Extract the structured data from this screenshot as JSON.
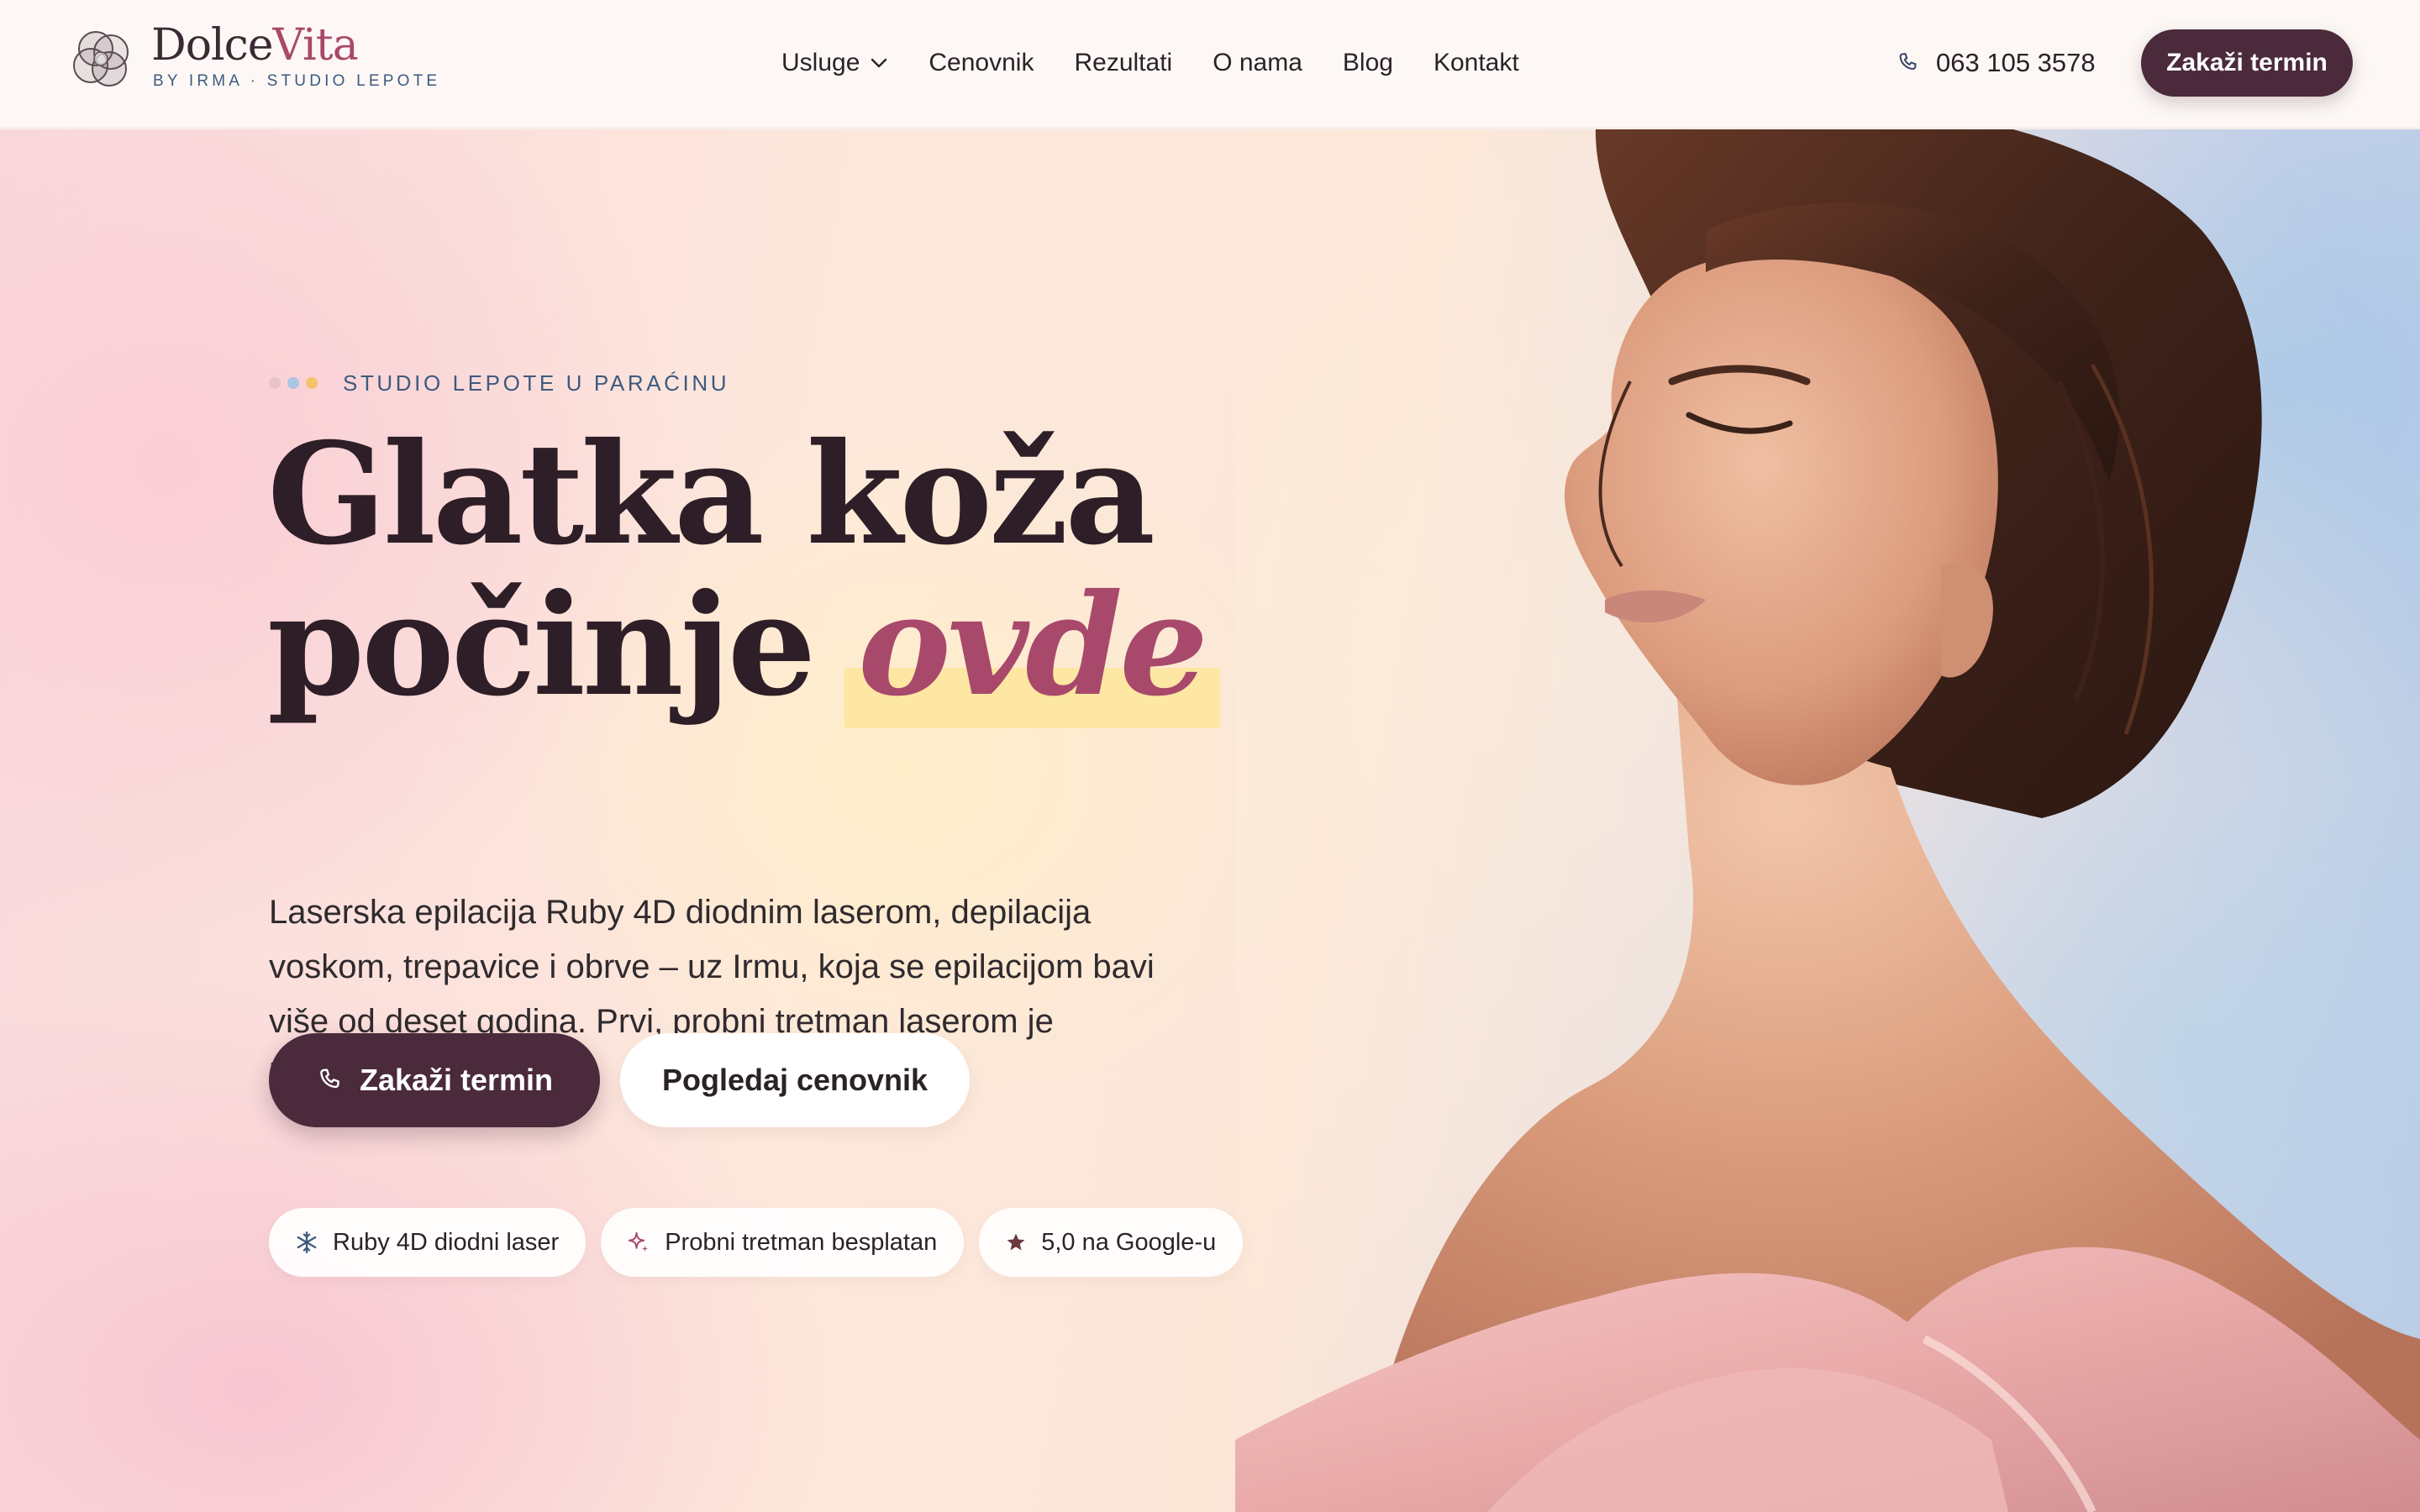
{
  "header": {
    "logo": {
      "title_main": "Dolce",
      "title_accent": "Vita",
      "subtitle": "BY IRMA · STUDIO LEPOTE"
    },
    "nav": [
      {
        "label": "Usluge",
        "has_dropdown": true
      },
      {
        "label": "Cenovnik"
      },
      {
        "label": "Rezultati"
      },
      {
        "label": "O nama"
      },
      {
        "label": "Blog"
      },
      {
        "label": "Kontakt"
      }
    ],
    "phone": "063 105 3578",
    "cta": "Zakaži termin"
  },
  "hero": {
    "eyebrow": "STUDIO LEPOTE U PARAĆINU",
    "eyebrow_dot_colors": [
      "#e8c4cc",
      "#a9c6e2",
      "#f3c46b"
    ],
    "headline_line1": "Glatka koža",
    "headline_line2_start": "počinje ",
    "headline_accent": "ovde",
    "lead": "Laserska epilacija Ruby 4D diodnim laserom, depilacija voskom, trepavice i obrve – uz Irmu, koja se epilacijom bavi više od deset godina. Prvi, probni tretman laserom je besplatan.",
    "primary_cta": "Zakaži termin",
    "secondary_cta": "Pogledaj cenovnik",
    "chips": [
      {
        "icon": "snowflake-icon",
        "label": "Ruby 4D diodni laser"
      },
      {
        "icon": "sparkle-icon",
        "label": "Probni tretman besplatan"
      },
      {
        "icon": "star-icon",
        "label": "5,0 na Google-u"
      }
    ]
  },
  "colors": {
    "brand_dark": "#4a2a3b",
    "accent_rose": "#a8496c",
    "accent_blue": "#3d5a80",
    "highlight_yellow": "#fde7a3"
  }
}
